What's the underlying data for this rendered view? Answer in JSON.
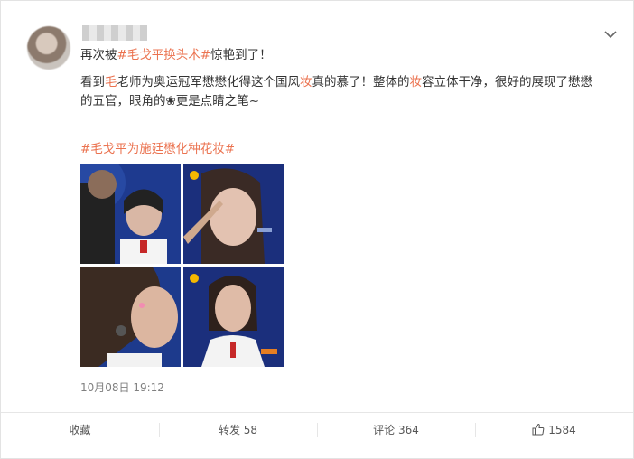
{
  "post": {
    "line1_a": "再次被",
    "line1_tag": "#毛戈平换头术#",
    "line1_b": "惊艳到了！",
    "line2_a": "看到",
    "line2_hl1": "毛",
    "line2_b": "老师为奥运冠军懋懋化得这个国风",
    "line2_hl2": "妆",
    "line2_c": "真的慕了！整体的",
    "line2_hl3": "妆",
    "line2_d": "容立体干净，很好的展现了懋懋",
    "line3": "的五官，眼角的❀更是点睛之笔~",
    "tag2": "#毛戈平为施廷懋化种花妆#",
    "timestamp": "10月08日 19:12"
  },
  "actions": {
    "favorite": "收藏",
    "repost": "转发 58",
    "comment": "评论 364",
    "like": "1584"
  },
  "icons": {
    "menu": "chevron-down-icon",
    "like": "thumbs-up-icon"
  },
  "colors": {
    "accent": "#eb7350",
    "photo_bg": "#1b2f7c"
  }
}
